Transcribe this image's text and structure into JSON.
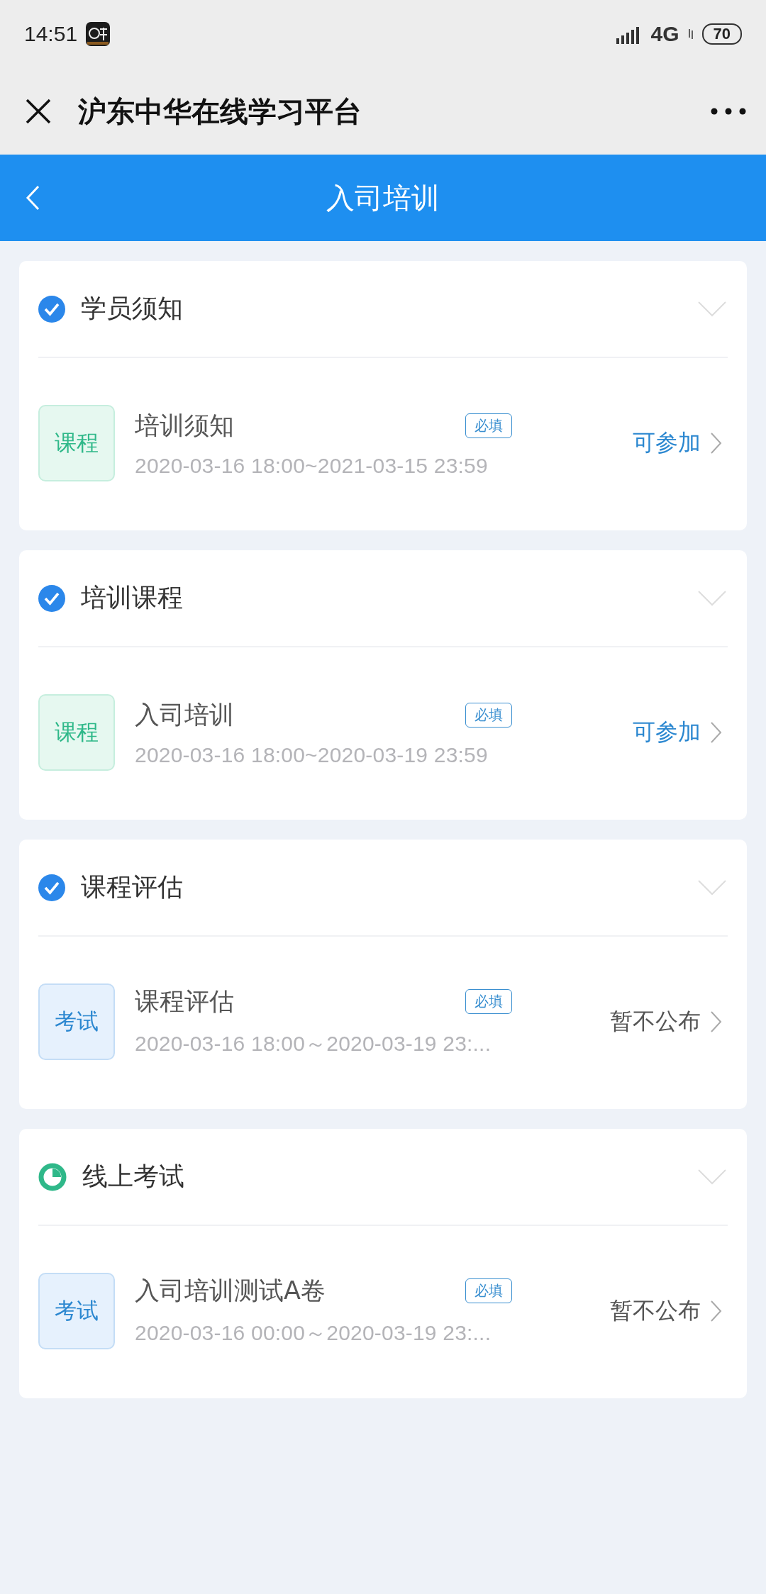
{
  "status_bar": {
    "time": "14:51",
    "network": "4G",
    "battery": "70"
  },
  "app_bar": {
    "title": "沪东中华在线学习平台"
  },
  "header": {
    "title": "入司培训"
  },
  "sections": [
    {
      "title": "学员须知",
      "completed": true,
      "expanded": false,
      "items": [
        {
          "kind": "course",
          "type_label": "课程",
          "title": "培训须知",
          "tag": "必填",
          "time": "2020-03-16 18:00~2021-03-15 23:59",
          "action": "可参加",
          "available": true
        }
      ]
    },
    {
      "title": "培训课程",
      "completed": true,
      "expanded": false,
      "items": [
        {
          "kind": "course",
          "type_label": "课程",
          "title": "入司培训",
          "tag": "必填",
          "time": "2020-03-16 18:00~2020-03-19 23:59",
          "action": "可参加",
          "available": true
        }
      ]
    },
    {
      "title": "课程评估",
      "completed": true,
      "expanded": false,
      "items": [
        {
          "kind": "exam",
          "type_label": "考试",
          "title": "课程评估",
          "tag": "必填",
          "time": "2020-03-16 18:00～2020-03-19 23:...",
          "action": "暂不公布",
          "available": false
        }
      ]
    },
    {
      "title": "线上考试",
      "completed": false,
      "expanded": false,
      "items": [
        {
          "kind": "exam",
          "type_label": "考试",
          "title": "入司培训测试A卷",
          "tag": "必填",
          "time": "2020-03-16 00:00～2020-03-19 23:...",
          "action": "暂不公布",
          "available": false
        }
      ]
    }
  ]
}
